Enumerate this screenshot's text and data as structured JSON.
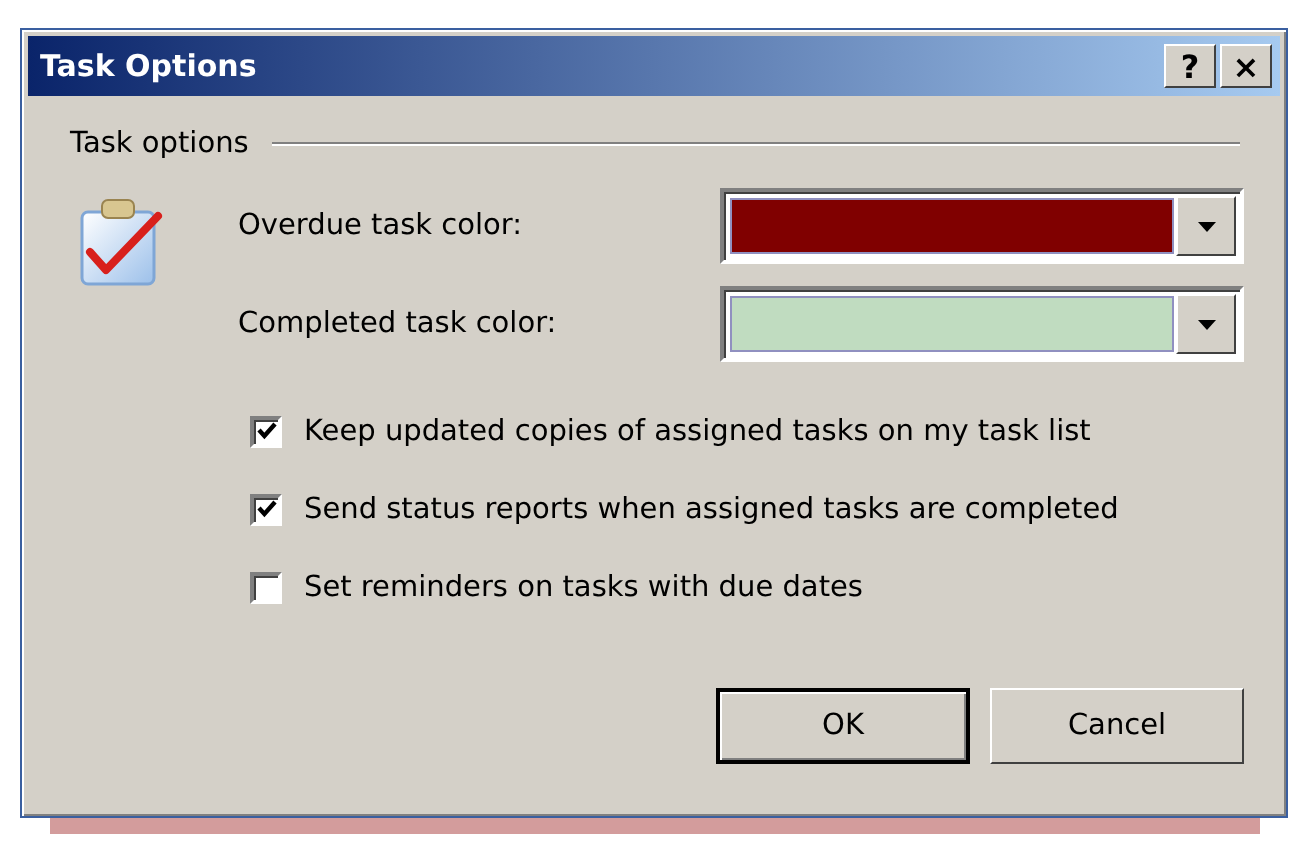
{
  "window": {
    "title": "Task Options",
    "title_buttons": [
      "?",
      "×"
    ]
  },
  "group": {
    "label": "Task options"
  },
  "color_fields": [
    {
      "label": "Overdue task color:",
      "color": "#800000"
    },
    {
      "label": "Completed task color:",
      "color": "#c0dcc0"
    }
  ],
  "checkboxes": [
    {
      "label": "Keep updated copies of assigned tasks on my task list",
      "checked": true
    },
    {
      "label": "Send status reports when assigned tasks are completed",
      "checked": true
    },
    {
      "label": "Set reminders on tasks with due dates",
      "checked": false
    }
  ],
  "buttons": [
    {
      "label": "OK",
      "default": true
    },
    {
      "label": "Cancel",
      "default": false
    }
  ]
}
